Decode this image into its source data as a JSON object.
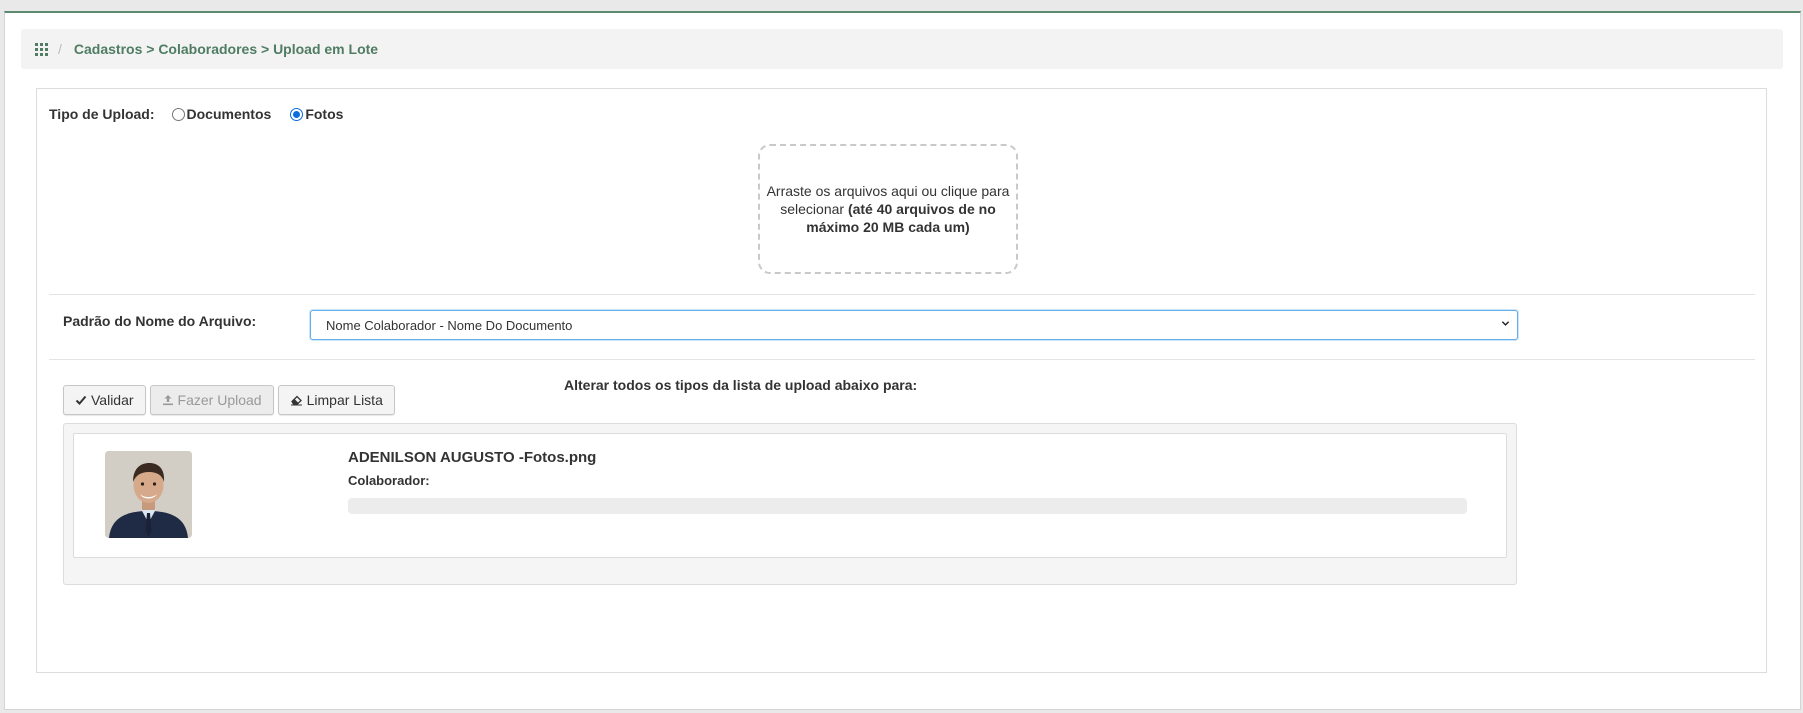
{
  "breadcrumb": {
    "icon": "apps-grid-icon",
    "separator": "/",
    "path": "Cadastros > Colaboradores > Upload em Lote"
  },
  "upload_type": {
    "label": "Tipo de Upload:",
    "options": [
      {
        "label": "Documentos",
        "checked": false
      },
      {
        "label": "Fotos",
        "checked": true
      }
    ]
  },
  "dropzone": {
    "text": "Arraste os arquivos aqui ou clique para selecionar",
    "limit_text": "(até 40 arquivos de no máximo 20 MB cada um)"
  },
  "filename_pattern": {
    "label": "Padrão do Nome do Arquivo:",
    "selected": "Nome Colaborador - Nome Do Documento"
  },
  "actions": {
    "validate_label": "Validar",
    "upload_label": "Fazer Upload",
    "clear_label": "Limpar Lista",
    "upload_disabled": true
  },
  "bulk_change_label": "Alterar todos os tipos da lista de upload abaixo para:",
  "upload_list": [
    {
      "file_name": "ADENILSON AUGUSTO -Fotos.png",
      "collaborator_label": "Colaborador:",
      "progress": 0
    }
  ],
  "colors": {
    "brand": "#4f7c63",
    "focus": "#66afe9",
    "radio_checked": "#0b6be0"
  }
}
